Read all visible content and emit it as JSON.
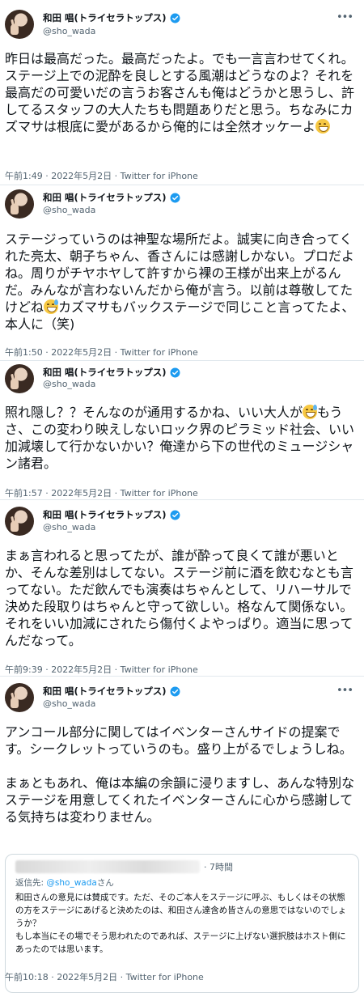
{
  "profile": {
    "display_name": "和田 唱(トライセラトップス)",
    "handle": "@sho_wada",
    "verified": true
  },
  "tweets": [
    {
      "text_parts": [
        "昨日は最高だった。最高だったよ。でも一言言わせてくれ。ステージ上での泥酔を良しとする風潮はどうなのよ？それを最高だの可愛いだの言うお客さんも俺はどうかと思うし、許してるスタッフの大人たちも問題ありだと思う。ちなみにカズマサは根底に愛があるから俺的には全然オッケーよ",
        ""
      ],
      "emoji": "grinning-face",
      "meta": "午前1:49 · 2022年5月2日 · Twitter for iPhone"
    },
    {
      "text_parts": [
        "ステージっていうのは神聖な場所だよ。誠実に向き合ってくれた亮太、朝子ちゃん、香さんには感謝しかない。プロだよね。周りがチヤホヤして許すから裸の王様が出来上がるんだ。みんなが言わないんだから俺が言う。以前は尊敬してたけどね",
        "カズマサもバックステージで同じこと言ってたよ、本人に（笑)"
      ],
      "emoji": "grinning-sweat-face",
      "meta": "午前1:50 · 2022年5月2日 · Twitter for iPhone"
    },
    {
      "text_parts": [
        "照れ隠し？？そんなのが通用するかね、いい大人が",
        "もうさ、この変わり映えしないロック界のピラミッド社会、いい加減壊して行かないかい？俺達から下の世代のミュージシャン諸君。"
      ],
      "emoji": "grinning-sweat-face",
      "meta": "午前1:57 · 2022年5月2日 · Twitter for iPhone"
    },
    {
      "text_parts": [
        "まぁ言われると思ってたが、誰が酔って良くて誰が悪いとか、そんな差別はしてない。ステージ前に酒を飲むなとも言ってない。ただ飲んでも演奏はちゃんとして、リハーサルで決めた段取りはちゃんと守って欲しい。格なんて関係ない。それをいい加減にされたら傷付くよやっぱり。適当に思ってんだなって。",
        ""
      ],
      "emoji": "",
      "meta": "午前9:39 · 2022年5月2日 · Twitter for iPhone"
    },
    {
      "text_parts": [
        "アンコール部分に関してはイベンターさんサイドの提案です。シークレットっていうのも。盛り上がるでしょうしね。\n\nまぁともあれ、俺は本編の余韻に浸りますし、あんな特別なステージを用意してくれたイベンターさんに心から感謝してる気持ちは変わりません。",
        ""
      ],
      "emoji": "",
      "meta": "午前10:18 · 2022年5月2日 · Twitter for iPhone"
    }
  ],
  "quote": {
    "time": "· 7時間",
    "reply_prefix": "返信先: ",
    "reply_handle": "@sho_wada",
    "reply_suffix": "さん",
    "text": "和田さんの意見には賛成です。ただ、そのご本人をステージに呼ぶ、もしくはその状態の方をステージにあげると決めたのは、和田さん達含め皆さんの意思ではないのでしょうか？\nもし本当にその場でそう思われたのであれば、ステージに上げない選択肢はホスト側にあったのでは思います。"
  },
  "colors": {
    "text": "#0f1419",
    "secondary": "#536471",
    "verified": "#1d9bf0",
    "divider": "#e1e8ed"
  },
  "icons": {
    "more": "more-horizontal-icon",
    "verified": "verified-badge-icon"
  }
}
